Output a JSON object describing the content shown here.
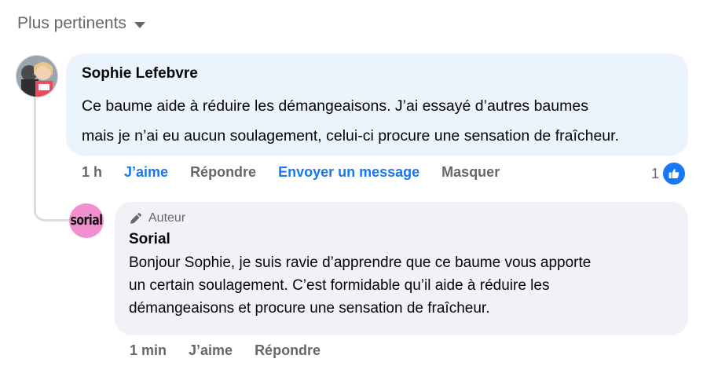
{
  "sort": {
    "label": "Plus pertinents"
  },
  "comment": {
    "author": "Sophie Lefebvre",
    "text_line1": "Ce baume aide à réduire les démangeaisons. J’ai essayé d’autres baumes",
    "text_line2": "mais je n’ai eu aucun soulagement, celui-ci procure une sensation de fraîcheur.",
    "time": "1 h",
    "like_label": "J’aime",
    "reply_label": "Répondre",
    "message_label": "Envoyer un message",
    "hide_label": "Masquer",
    "reaction_count": "1",
    "bubble_color": "#ebf3fc",
    "accent_color": "#1877f2"
  },
  "reply": {
    "badge": "Auteur",
    "author": "Sorial",
    "avatar_text": "sorial",
    "avatar_color": "#f28fcf",
    "text_line1": "Bonjour Sophie, je suis ravie d’apprendre que ce baume vous apporte",
    "text_line2": "un certain soulagement. C’est formidable qu’il aide à réduire les",
    "text_line3": "démangeaisons et procure une sensation de fraîcheur.",
    "time": "1 min",
    "like_label": "J’aime",
    "reply_label": "Répondre",
    "bubble_color": "#f0f2f5"
  },
  "icons": {
    "sort": "caret-down-icon",
    "badge": "pencil-icon",
    "reaction": "thumbs-up-icon"
  }
}
